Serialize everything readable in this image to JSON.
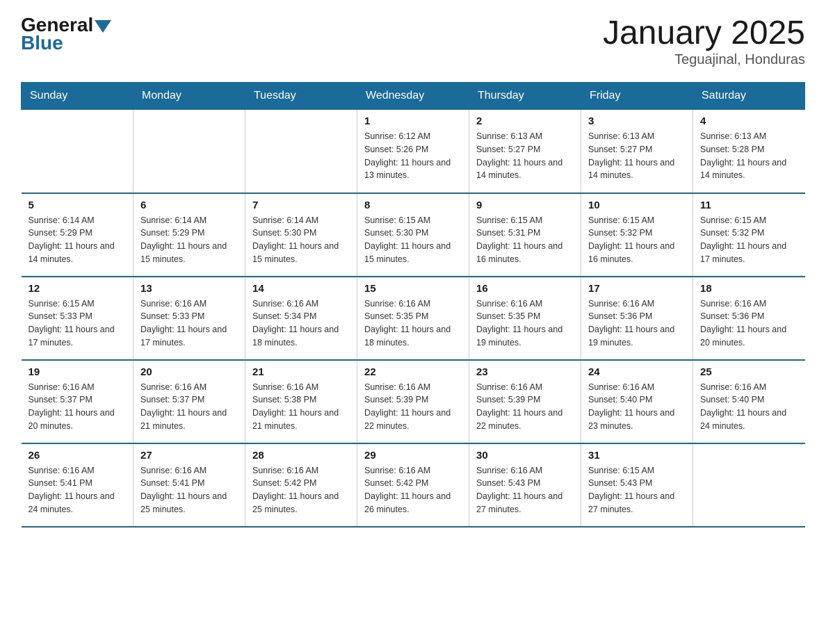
{
  "logo": {
    "general": "General",
    "blue": "Blue"
  },
  "title": "January 2025",
  "subtitle": "Teguajinal, Honduras",
  "days_of_week": [
    "Sunday",
    "Monday",
    "Tuesday",
    "Wednesday",
    "Thursday",
    "Friday",
    "Saturday"
  ],
  "weeks": [
    [
      {
        "day": "",
        "info": ""
      },
      {
        "day": "",
        "info": ""
      },
      {
        "day": "",
        "info": ""
      },
      {
        "day": "1",
        "info": "Sunrise: 6:12 AM\nSunset: 5:26 PM\nDaylight: 11 hours and 13 minutes."
      },
      {
        "day": "2",
        "info": "Sunrise: 6:13 AM\nSunset: 5:27 PM\nDaylight: 11 hours and 14 minutes."
      },
      {
        "day": "3",
        "info": "Sunrise: 6:13 AM\nSunset: 5:27 PM\nDaylight: 11 hours and 14 minutes."
      },
      {
        "day": "4",
        "info": "Sunrise: 6:13 AM\nSunset: 5:28 PM\nDaylight: 11 hours and 14 minutes."
      }
    ],
    [
      {
        "day": "5",
        "info": "Sunrise: 6:14 AM\nSunset: 5:29 PM\nDaylight: 11 hours and 14 minutes."
      },
      {
        "day": "6",
        "info": "Sunrise: 6:14 AM\nSunset: 5:29 PM\nDaylight: 11 hours and 15 minutes."
      },
      {
        "day": "7",
        "info": "Sunrise: 6:14 AM\nSunset: 5:30 PM\nDaylight: 11 hours and 15 minutes."
      },
      {
        "day": "8",
        "info": "Sunrise: 6:15 AM\nSunset: 5:30 PM\nDaylight: 11 hours and 15 minutes."
      },
      {
        "day": "9",
        "info": "Sunrise: 6:15 AM\nSunset: 5:31 PM\nDaylight: 11 hours and 16 minutes."
      },
      {
        "day": "10",
        "info": "Sunrise: 6:15 AM\nSunset: 5:32 PM\nDaylight: 11 hours and 16 minutes."
      },
      {
        "day": "11",
        "info": "Sunrise: 6:15 AM\nSunset: 5:32 PM\nDaylight: 11 hours and 17 minutes."
      }
    ],
    [
      {
        "day": "12",
        "info": "Sunrise: 6:15 AM\nSunset: 5:33 PM\nDaylight: 11 hours and 17 minutes."
      },
      {
        "day": "13",
        "info": "Sunrise: 6:16 AM\nSunset: 5:33 PM\nDaylight: 11 hours and 17 minutes."
      },
      {
        "day": "14",
        "info": "Sunrise: 6:16 AM\nSunset: 5:34 PM\nDaylight: 11 hours and 18 minutes."
      },
      {
        "day": "15",
        "info": "Sunrise: 6:16 AM\nSunset: 5:35 PM\nDaylight: 11 hours and 18 minutes."
      },
      {
        "day": "16",
        "info": "Sunrise: 6:16 AM\nSunset: 5:35 PM\nDaylight: 11 hours and 19 minutes."
      },
      {
        "day": "17",
        "info": "Sunrise: 6:16 AM\nSunset: 5:36 PM\nDaylight: 11 hours and 19 minutes."
      },
      {
        "day": "18",
        "info": "Sunrise: 6:16 AM\nSunset: 5:36 PM\nDaylight: 11 hours and 20 minutes."
      }
    ],
    [
      {
        "day": "19",
        "info": "Sunrise: 6:16 AM\nSunset: 5:37 PM\nDaylight: 11 hours and 20 minutes."
      },
      {
        "day": "20",
        "info": "Sunrise: 6:16 AM\nSunset: 5:37 PM\nDaylight: 11 hours and 21 minutes."
      },
      {
        "day": "21",
        "info": "Sunrise: 6:16 AM\nSunset: 5:38 PM\nDaylight: 11 hours and 21 minutes."
      },
      {
        "day": "22",
        "info": "Sunrise: 6:16 AM\nSunset: 5:39 PM\nDaylight: 11 hours and 22 minutes."
      },
      {
        "day": "23",
        "info": "Sunrise: 6:16 AM\nSunset: 5:39 PM\nDaylight: 11 hours and 22 minutes."
      },
      {
        "day": "24",
        "info": "Sunrise: 6:16 AM\nSunset: 5:40 PM\nDaylight: 11 hours and 23 minutes."
      },
      {
        "day": "25",
        "info": "Sunrise: 6:16 AM\nSunset: 5:40 PM\nDaylight: 11 hours and 24 minutes."
      }
    ],
    [
      {
        "day": "26",
        "info": "Sunrise: 6:16 AM\nSunset: 5:41 PM\nDaylight: 11 hours and 24 minutes."
      },
      {
        "day": "27",
        "info": "Sunrise: 6:16 AM\nSunset: 5:41 PM\nDaylight: 11 hours and 25 minutes."
      },
      {
        "day": "28",
        "info": "Sunrise: 6:16 AM\nSunset: 5:42 PM\nDaylight: 11 hours and 25 minutes."
      },
      {
        "day": "29",
        "info": "Sunrise: 6:16 AM\nSunset: 5:42 PM\nDaylight: 11 hours and 26 minutes."
      },
      {
        "day": "30",
        "info": "Sunrise: 6:16 AM\nSunset: 5:43 PM\nDaylight: 11 hours and 27 minutes."
      },
      {
        "day": "31",
        "info": "Sunrise: 6:15 AM\nSunset: 5:43 PM\nDaylight: 11 hours and 27 minutes."
      },
      {
        "day": "",
        "info": ""
      }
    ]
  ]
}
